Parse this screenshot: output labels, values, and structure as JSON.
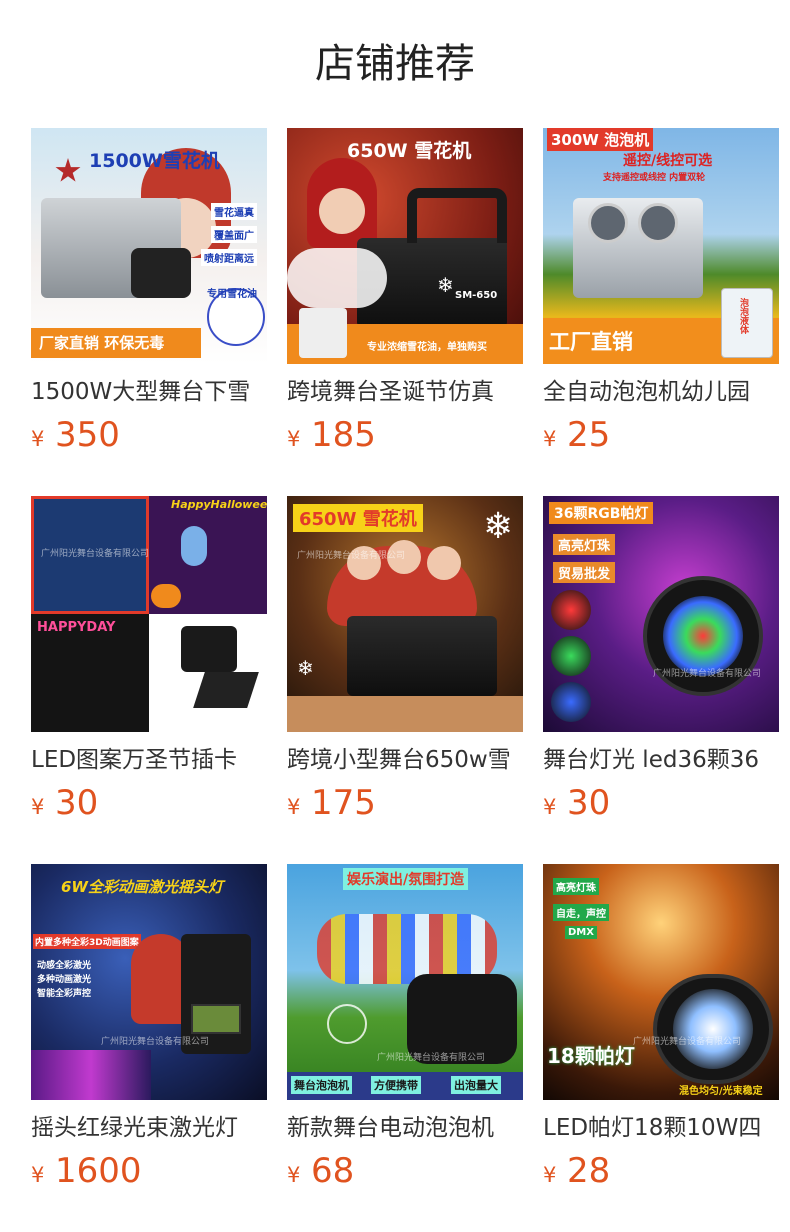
{
  "section_title": "店铺推荐",
  "currency_symbol": "¥",
  "products": [
    {
      "name": "1500W大型舞台下雪",
      "price": "350",
      "banner": "1500W雪花机",
      "tags": [
        "雪花逼真",
        "覆盖面广",
        "喷射距离远",
        "专用雪花油"
      ],
      "footer": "厂家直销 环保无毒"
    },
    {
      "name": "跨境舞台圣诞节仿真",
      "price": "185",
      "banner": "650W 雪花机",
      "badge": "SM-650",
      "footer": "专业浓缩雪花油，单独购买"
    },
    {
      "name": "全自动泡泡机幼儿园",
      "price": "25",
      "banner": "300W 泡泡机",
      "sub": "遥控/线控可选",
      "sub2": "支持遥控或线控 内置双轮",
      "footer": "工厂直销",
      "tag": "泡泡液体"
    },
    {
      "name": "LED图案万圣节插卡",
      "price": "30",
      "banner": "HappyHalloween",
      "sub": "HAPPYDAY",
      "watermark": "广州阳光舞台设备有限公司"
    },
    {
      "name": "跨境小型舞台650w雪",
      "price": "175",
      "banner": "650W 雪花机",
      "watermark": "广州阳光舞台设备有限公司"
    },
    {
      "name": "舞台灯光 led36颗36",
      "price": "30",
      "banner": "36颗RGB帕灯",
      "tags": [
        "高亮灯珠",
        "贸易批发"
      ],
      "watermark": "广州阳光舞台设备有限公司"
    },
    {
      "name": "摇头红绿光束激光灯",
      "price": "1600",
      "banner": "6W全彩动画激光摇头灯",
      "sub": "内置多种全彩3D动画图案",
      "tags": [
        "动感全彩激光",
        "多种动画激光",
        "智能全彩声控"
      ],
      "watermark": "广州阳光舞台设备有限公司"
    },
    {
      "name": "新款舞台电动泡泡机",
      "price": "68",
      "banner": "娱乐演出/氛围打造",
      "tags": [
        "舞台泡泡机",
        "方便携带",
        "出泡量大"
      ],
      "watermark": "广州阳光舞台设备有限公司"
    },
    {
      "name": "LED帕灯18颗10W四",
      "price": "28",
      "banner": "高亮灯珠",
      "tags": [
        "自走，声控",
        "DMX"
      ],
      "sub": "18颗帕灯",
      "footer": "混色均匀/光束稳定",
      "watermark": "广州阳光舞台设备有限公司"
    }
  ],
  "colors": {
    "price": "#e0531f",
    "title": "#222222",
    "name": "#333333"
  }
}
